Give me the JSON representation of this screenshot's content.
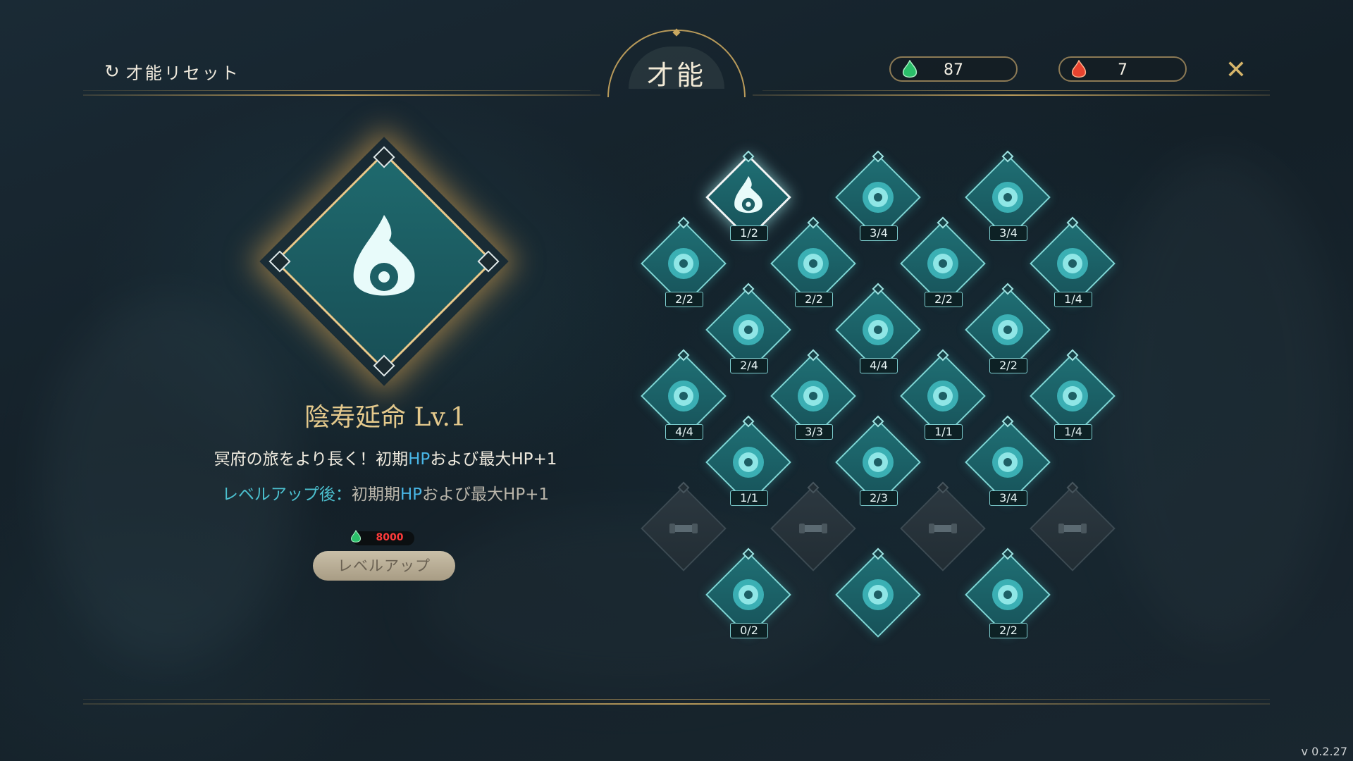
{
  "header": {
    "reset_label": "才能リセット",
    "title": "才能",
    "currencies": [
      {
        "name": "green-soul",
        "value": "87",
        "color": "#2bbf6a"
      },
      {
        "name": "red-flame",
        "value": "7",
        "color": "#e8432f"
      }
    ]
  },
  "detail": {
    "title": "陰寿延命 Lv.1",
    "desc_pre": "冥府の旅をより長く！初期",
    "desc_hl": "HP",
    "desc_post": "および最大HP+1",
    "next_label": "レベルアップ後：",
    "next_pre": "初期期",
    "next_hl": "HP",
    "next_post": "および最大HP+1",
    "cost": "8000",
    "button_label": "レベルアップ"
  },
  "talents": [
    {
      "icon": "soul-flame-eye-icon",
      "level": "1/2"
    },
    {
      "icon": "rune-coin-icon",
      "level": "3/4"
    },
    {
      "icon": "lightning-strike-icon",
      "level": "3/4"
    },
    {
      "icon": "jar-creature-icon",
      "level": "2/2"
    },
    {
      "icon": "scroll-banner-icon",
      "level": "2/2"
    },
    {
      "icon": "flower-rune-icon",
      "level": "2/2"
    },
    {
      "icon": "fire-card-icon",
      "level": "1/4"
    },
    {
      "icon": "flame-icon",
      "level": "2/4"
    },
    {
      "icon": "big-flame-icon",
      "level": "4/4"
    },
    {
      "icon": "flame-plus-icon",
      "level": "2/2"
    },
    {
      "icon": "card-bird-icon",
      "level": "4/4"
    },
    {
      "icon": "card-swap-icon",
      "level": "3/3"
    },
    {
      "icon": "tea-cup-icon",
      "level": "1/1"
    },
    {
      "icon": "bottle-icon",
      "level": "1/4"
    },
    {
      "icon": "shop-banner-icon",
      "level": "1/1"
    },
    {
      "icon": "totem-banner-icon",
      "level": "2/3"
    },
    {
      "icon": "horned-shrine-icon",
      "level": "3/4"
    },
    {
      "icon": "locked-icon",
      "level": ""
    },
    {
      "icon": "locked-icon",
      "level": ""
    },
    {
      "icon": "locked-icon",
      "level": ""
    },
    {
      "icon": "locked-icon",
      "level": ""
    },
    {
      "icon": "crescent-moon-icon",
      "level": "0/2"
    },
    {
      "icon": "spirit-stone-icon",
      "level": ""
    },
    {
      "icon": "bear-mask-icon",
      "level": "2/2"
    }
  ],
  "version": "v 0.2.27"
}
